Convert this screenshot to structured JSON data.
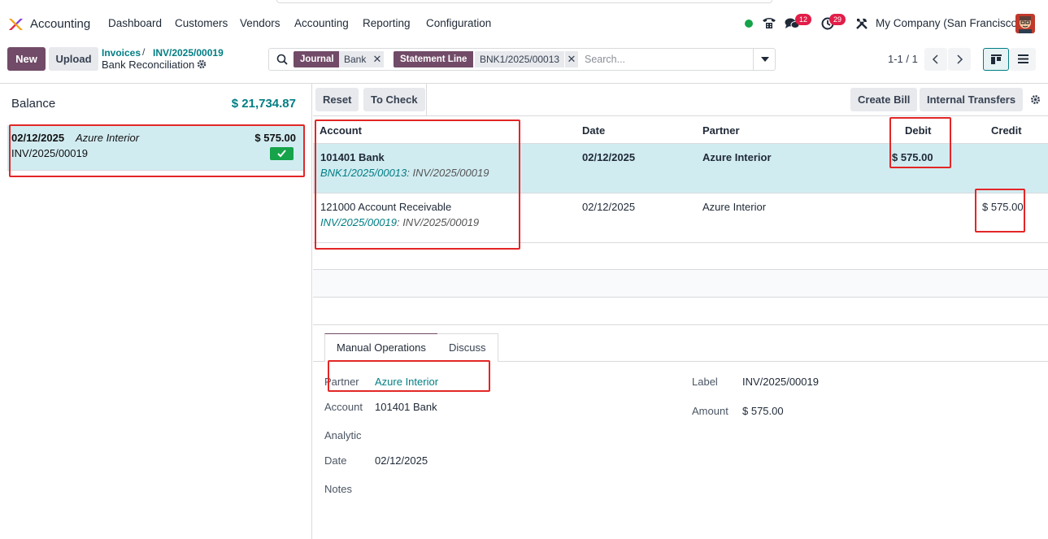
{
  "navbar": {
    "app_name": "Accounting",
    "menu": [
      "Dashboard",
      "Customers",
      "Vendors",
      "Accounting",
      "Reporting",
      "Configuration"
    ],
    "messages_badge": "12",
    "activities_badge": "29",
    "company": "My Company (San Francisco)"
  },
  "control": {
    "new_label": "New",
    "upload_label": "Upload",
    "breadcrumb_link_1": "Invoices",
    "breadcrumb_sep": "/",
    "breadcrumb_link_2": "INV/2025/00019",
    "breadcrumb_current": "Bank Reconciliation"
  },
  "search": {
    "facets": [
      {
        "label": "Journal",
        "value": "Bank"
      },
      {
        "label": "Statement Line",
        "value": "BNK1/2025/00013"
      }
    ],
    "placeholder": "Search..."
  },
  "pager": {
    "text": "1-1 / 1"
  },
  "left": {
    "balance_label": "Balance",
    "balance_value": "$ 21,734.87",
    "statement_line": {
      "date": "02/12/2025",
      "partner": "Azure Interior",
      "amount": "$ 575.00",
      "ref": "INV/2025/00019"
    }
  },
  "toolbar": {
    "reset": "Reset",
    "to_check": "To Check",
    "create_bill": "Create Bill",
    "internal_transfers": "Internal Transfers"
  },
  "grid": {
    "headers": {
      "account": "Account",
      "date": "Date",
      "partner": "Partner",
      "debit": "Debit",
      "credit": "Credit"
    },
    "rows": [
      {
        "account": "101401 Bank",
        "sub_link": "BNK1/2025/00013",
        "sub_text": ": INV/2025/00019",
        "date": "02/12/2025",
        "partner": "Azure Interior",
        "debit": "$ 575.00",
        "credit": ""
      },
      {
        "account": "121000 Account Receivable",
        "sub_link": "INV/2025/00019",
        "sub_text": ": INV/2025/00019",
        "date": "02/12/2025",
        "partner": "Azure Interior",
        "debit": "",
        "credit": "$ 575.00"
      }
    ]
  },
  "tabs": {
    "manual": "Manual Operations",
    "discuss": "Discuss"
  },
  "form": {
    "partner_label": "Partner",
    "partner_value": "Azure Interior",
    "account_label": "Account",
    "account_value": "101401 Bank",
    "analytic_label": "Analytic",
    "date_label": "Date",
    "date_value": "02/12/2025",
    "notes_label": "Notes",
    "label_label": "Label",
    "label_value": "INV/2025/00019",
    "amount_label": "Amount",
    "amount_value": "$ 575.00"
  },
  "colors": {
    "primary": "#714b67",
    "teal": "#017e84",
    "selected_row": "#d1ecf1",
    "annotation": "#e32626"
  }
}
